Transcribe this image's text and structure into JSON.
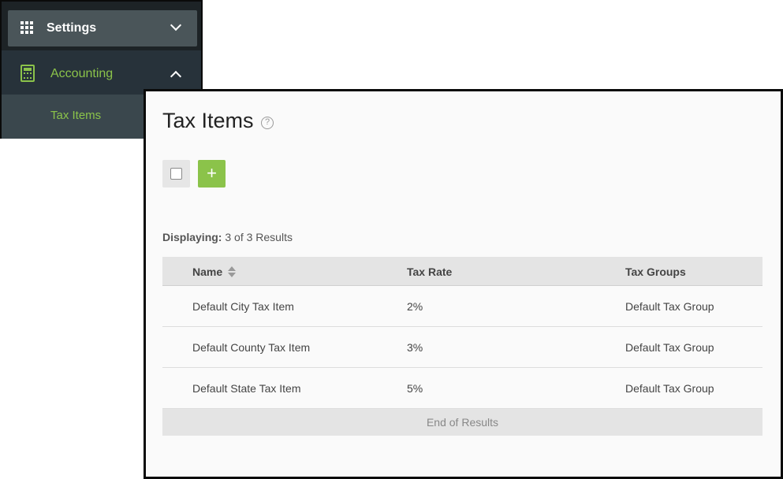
{
  "sidebar": {
    "settings_label": "Settings",
    "accounting_label": "Accounting",
    "tax_items_label": "Tax Items",
    "accent_color": "#8bc34a"
  },
  "main": {
    "title": "Tax Items",
    "help_glyph": "?",
    "add_glyph": "+",
    "displaying_label": "Displaying:",
    "displaying_value": "3 of 3 Results",
    "table": {
      "columns": [
        "Name",
        "Tax Rate",
        "Tax Groups"
      ],
      "rows": [
        [
          "Default City Tax Item",
          "2%",
          "Default Tax Group"
        ],
        [
          "Default County Tax Item",
          "3%",
          "Default Tax Group"
        ],
        [
          "Default State Tax Item",
          "5%",
          "Default Tax Group"
        ]
      ],
      "footer": "End of Results"
    }
  }
}
